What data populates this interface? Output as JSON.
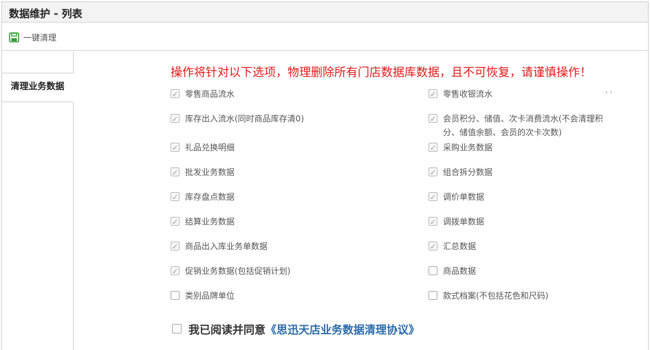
{
  "header": {
    "title": "数据维护 - 列表"
  },
  "toolbar": {
    "clean_label": "一键清理",
    "clean_icon": "save-icon"
  },
  "sidebar": {
    "tabs": [
      {
        "label": "清理业务数据"
      }
    ]
  },
  "main": {
    "warning": "操作将针对以下选项，物理删除所有门店数据库数据，且不可恢复，请谨慎操作！",
    "corner_mark": ", ,",
    "options": [
      {
        "label": "零售商品流水",
        "checked": true
      },
      {
        "label": "零售收银流水",
        "checked": true
      },
      {
        "label": "库存出入流水(同时商品库存清0)",
        "checked": true
      },
      {
        "label": "会员积分、储值、次卡消费流水(不会清理积分、储值余额、会员的次卡次数)",
        "checked": true
      },
      {
        "label": "礼品兑换明细",
        "checked": true
      },
      {
        "label": "采购业务数据",
        "checked": true
      },
      {
        "label": "批发业务数据",
        "checked": true
      },
      {
        "label": "组合拆分数据",
        "checked": true
      },
      {
        "label": "库存盘点数据",
        "checked": true
      },
      {
        "label": "调价单数据",
        "checked": true
      },
      {
        "label": "结算业务数据",
        "checked": true
      },
      {
        "label": "调拨单数据",
        "checked": true
      },
      {
        "label": "商品出入库业务单数据",
        "checked": true
      },
      {
        "label": "汇总数据",
        "checked": true
      },
      {
        "label": "促销业务数据(包括促销计划)",
        "checked": true
      },
      {
        "label": "商品数据",
        "checked": false
      },
      {
        "label": "类别品牌单位",
        "checked": false
      },
      {
        "label": "款式档案(不包括花色和尺码)",
        "checked": false
      }
    ],
    "agreement": {
      "prefix": "我已阅读并同意",
      "link": "《思迅天店业务数据清理协议》",
      "checked": false
    }
  }
}
